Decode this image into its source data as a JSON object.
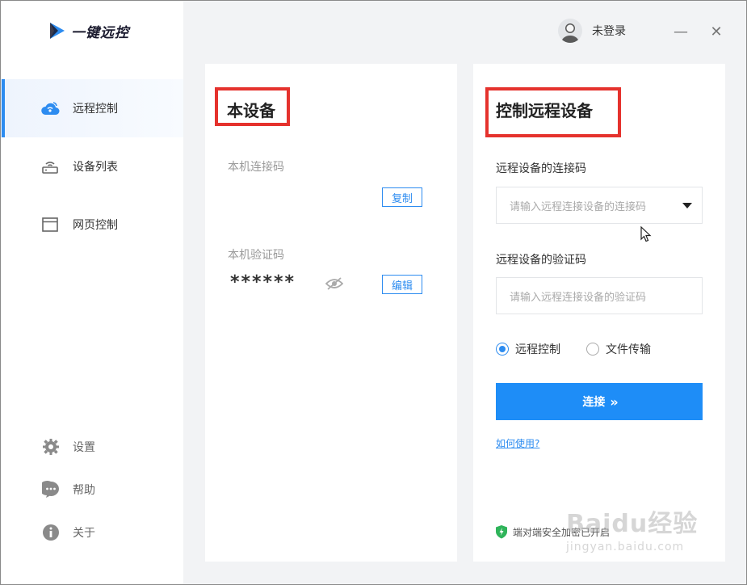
{
  "app": {
    "logo_text": "一键远控"
  },
  "header": {
    "user_name": "未登录",
    "minimize_glyph": "—",
    "close_glyph": "✕"
  },
  "sidebar": {
    "items": [
      {
        "label": "远程控制",
        "icon": "cloud-remote-icon",
        "active": true
      },
      {
        "label": "设备列表",
        "icon": "router-icon",
        "active": false
      },
      {
        "label": "网页控制",
        "icon": "browser-window-icon",
        "active": false
      }
    ],
    "bottom": [
      {
        "label": "设置",
        "icon": "gear-icon"
      },
      {
        "label": "帮助",
        "icon": "chat-help-icon"
      },
      {
        "label": "关于",
        "icon": "info-icon"
      }
    ]
  },
  "local_device": {
    "title": "本设备",
    "connection_code_label": "本机连接码",
    "copy_button": "复制",
    "verify_code_label": "本机验证码",
    "verify_code_masked": "******",
    "edit_button": "编辑"
  },
  "remote_control": {
    "title": "控制远程设备",
    "connection_code_label": "远程设备的连接码",
    "connection_code_placeholder": "请输入远程连接设备的连接码",
    "verify_code_label": "远程设备的验证码",
    "verify_code_placeholder": "请输入远程连接设备的验证码",
    "mode_options": [
      {
        "label": "远程控制",
        "checked": true
      },
      {
        "label": "文件传输",
        "checked": false
      }
    ],
    "connect_button": "连接",
    "connect_arrows": "»",
    "help_link": "如何使用?",
    "security_note": "端对端安全加密已开启"
  },
  "watermark": {
    "main": "Baidu经验",
    "sub": "jingyan.baidu.com"
  },
  "colors": {
    "accent": "#1e8df7",
    "highlight_box": "#e5322d",
    "secure_green": "#2fb45a"
  }
}
